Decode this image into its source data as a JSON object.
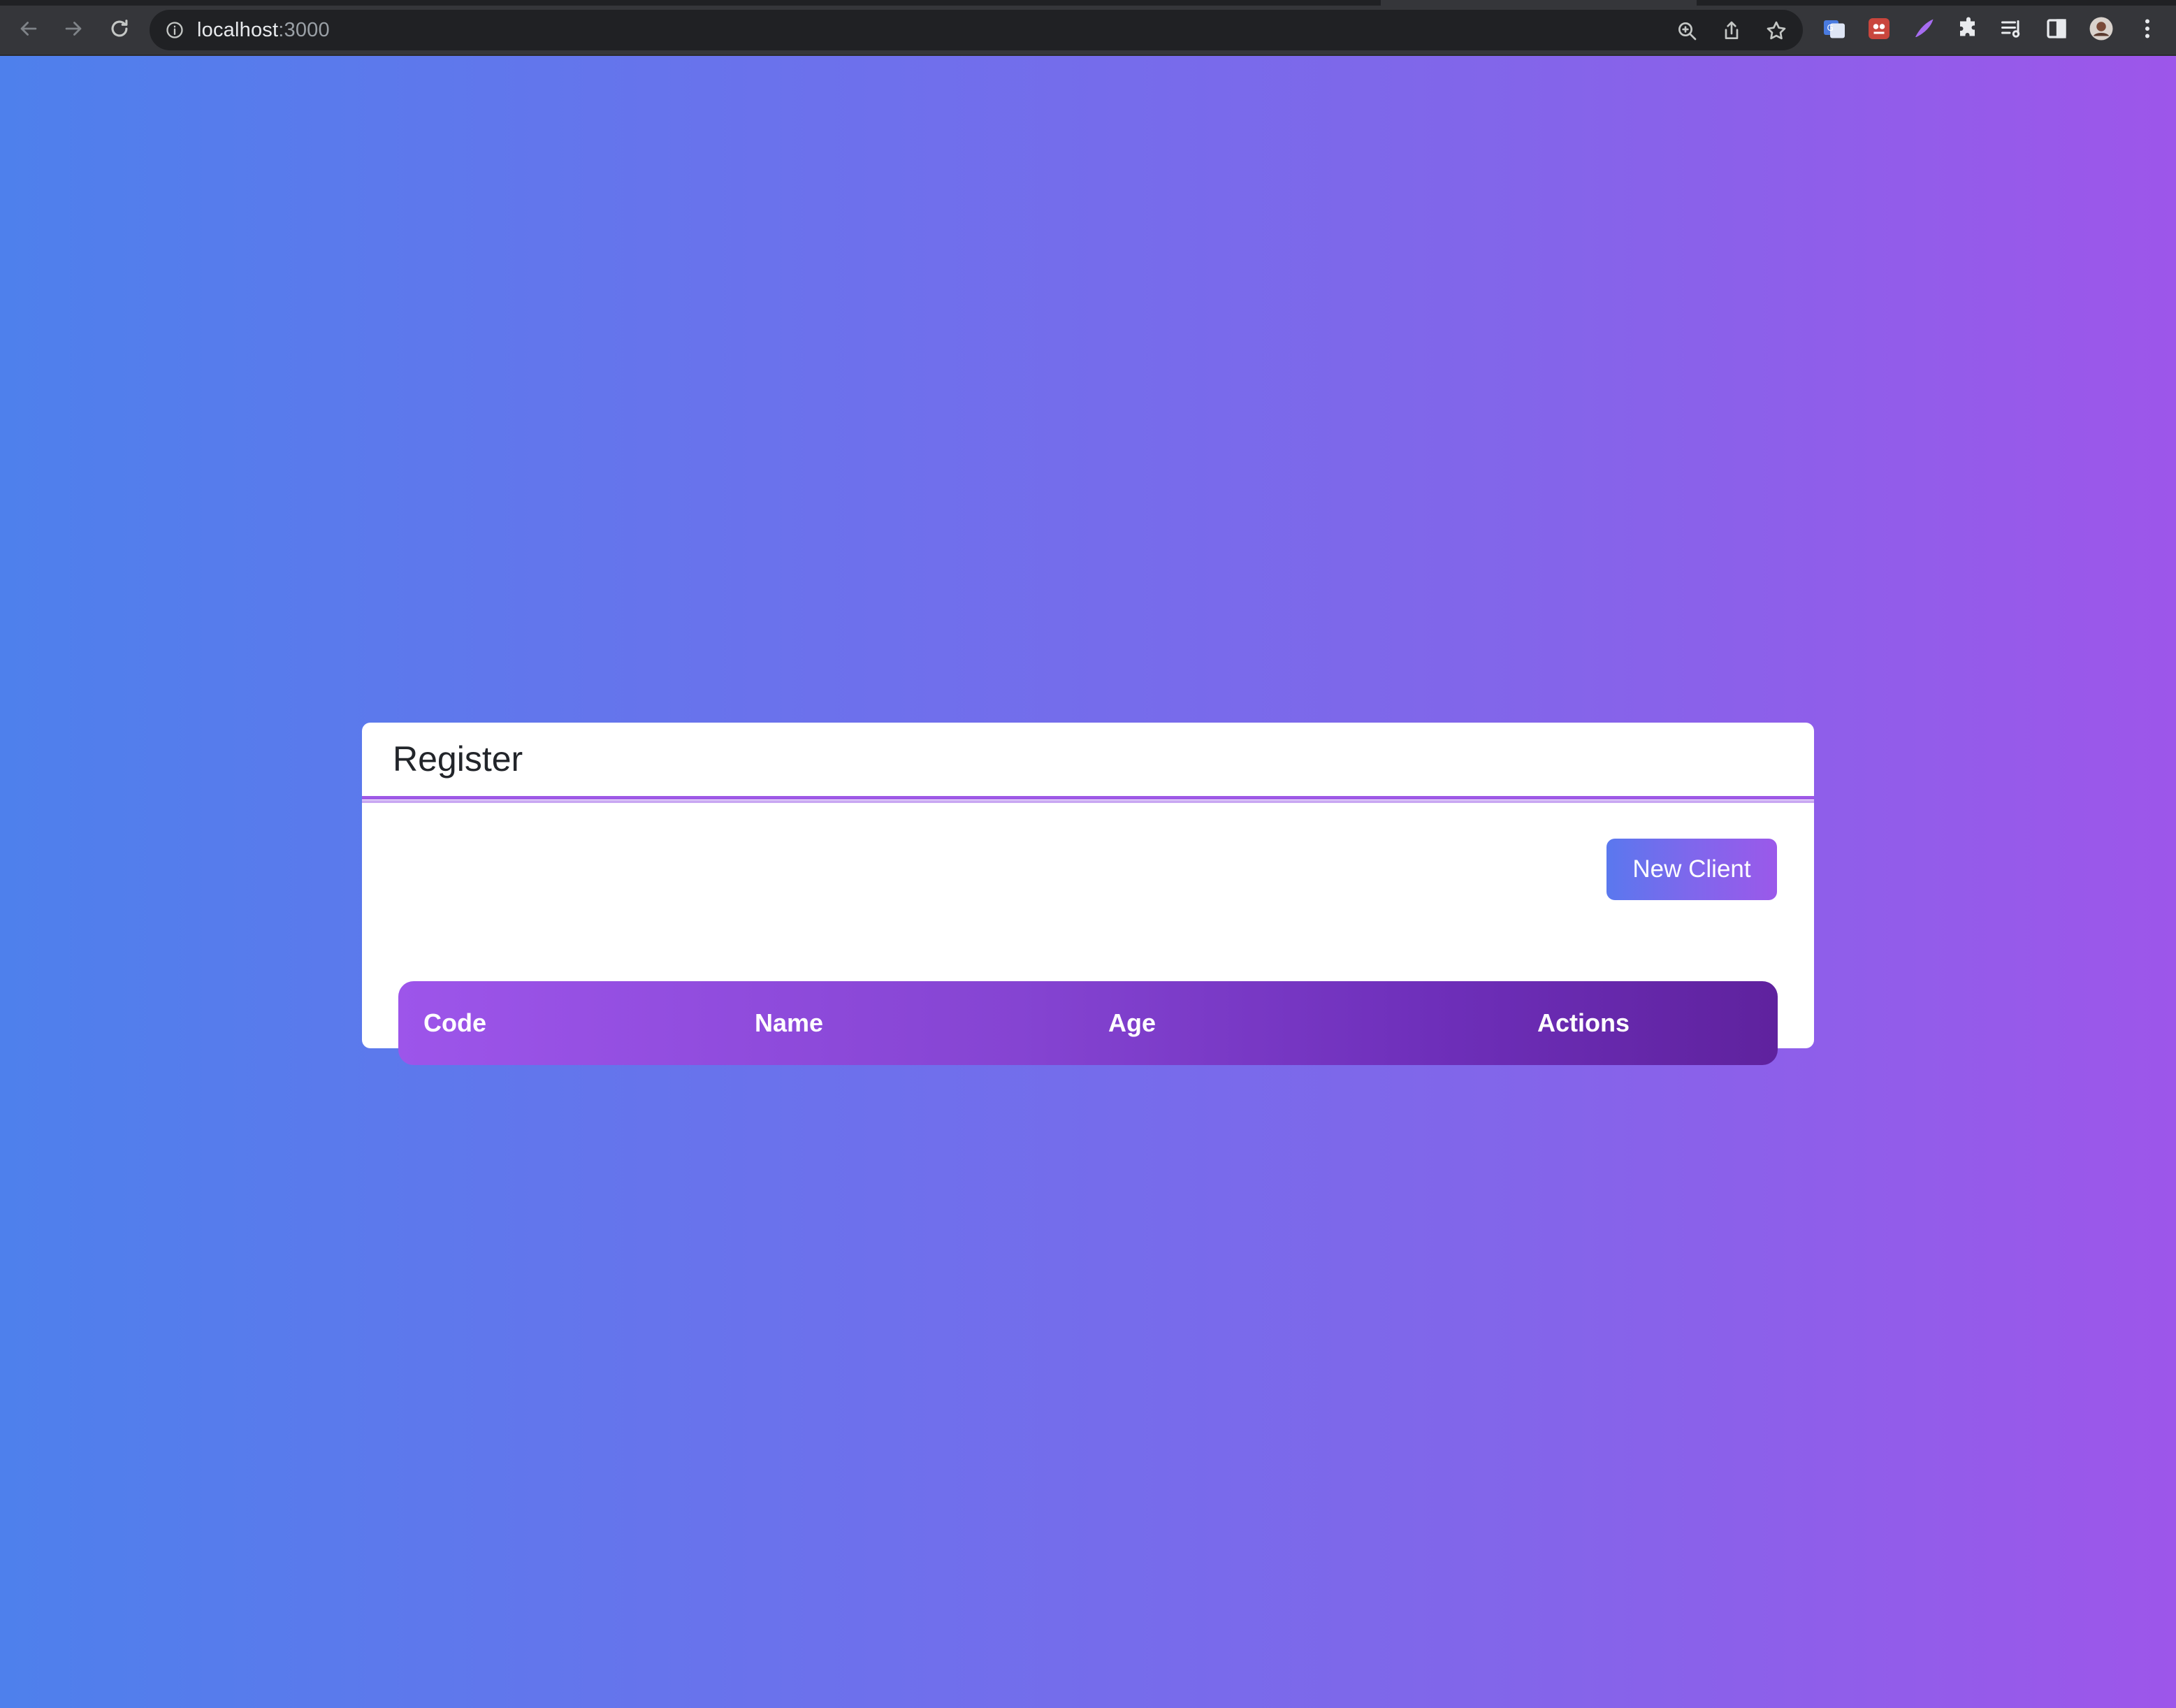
{
  "browser": {
    "url_host": "localhost",
    "url_port": ":3000",
    "icons": {
      "back": "arrow-left-icon",
      "forward": "arrow-right-icon",
      "reload": "reload-icon",
      "site_info": "info-icon",
      "zoom": "zoom-icon",
      "share": "share-icon",
      "bookmark": "star-icon",
      "extensions": [
        "translate-extension-icon",
        "red-extension-icon",
        "feather-extension-icon",
        "puzzle-icon",
        "reading-list-icon",
        "side-panel-icon",
        "profile-avatar",
        "kebab-menu-icon"
      ]
    }
  },
  "page": {
    "background_colors": [
      "#4e80ec",
      "#9d56ea"
    ],
    "card": {
      "title": "Register",
      "new_client_label": "New Client",
      "table": {
        "headers": [
          "Code",
          "Name",
          "Age",
          "Actions"
        ],
        "rows": []
      }
    }
  }
}
